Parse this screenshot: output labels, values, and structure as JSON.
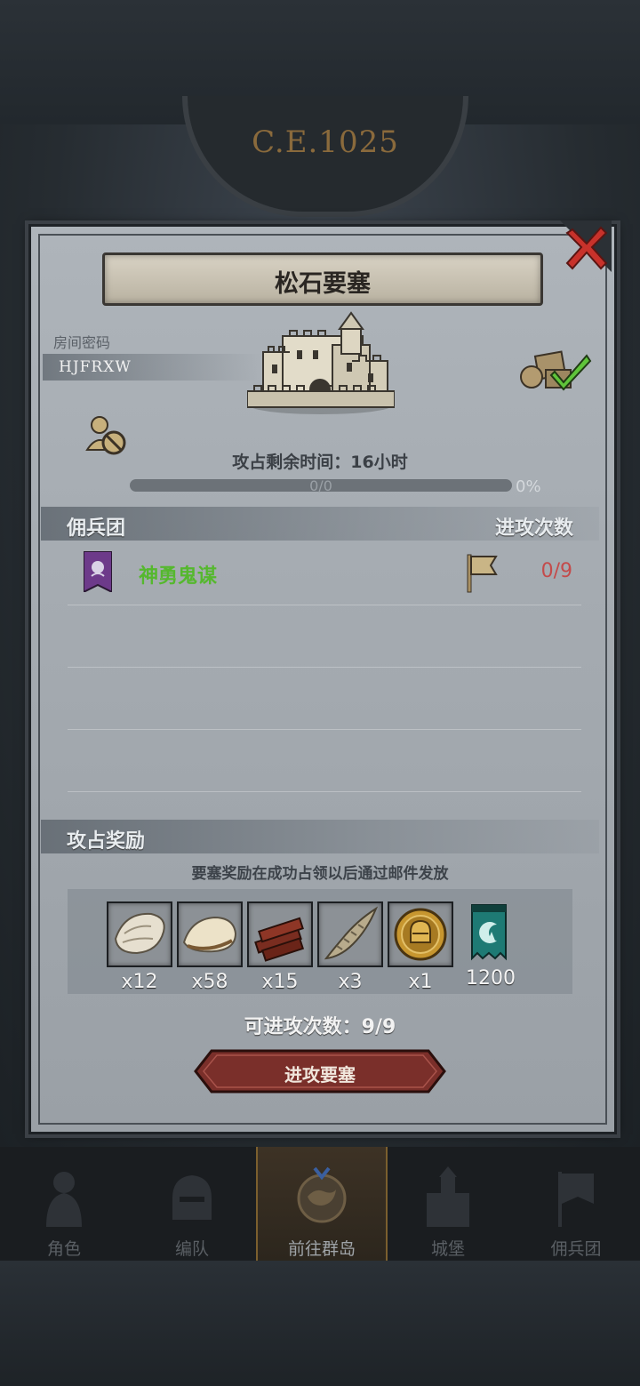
{
  "background": {
    "era_label": "C.E.1025"
  },
  "dialog": {
    "title": "松石要塞",
    "room_label": "房间密码",
    "room_code": "HJFRXW",
    "timer_label": "攻占剩余时间：16小时",
    "progress_text": "0/0",
    "progress_percent_text": "0%",
    "progress_value": 0
  },
  "mercenary": {
    "header_left": "佣兵团",
    "header_right": "进攻次数",
    "rows": [
      {
        "name": "神勇鬼谋",
        "attacks": "0/9"
      }
    ]
  },
  "rewards": {
    "header": "攻占奖励",
    "note": "要塞奖励在成功占领以后通过邮件发放",
    "items": [
      {
        "icon": "fur-pelt-icon",
        "qty": "x12"
      },
      {
        "icon": "wool-hide-icon",
        "qty": "x58"
      },
      {
        "icon": "wood-planks-icon",
        "qty": "x15"
      },
      {
        "icon": "horn-icon",
        "qty": "x3"
      },
      {
        "icon": "gold-helmet-coin-icon",
        "qty": "x1"
      },
      {
        "icon": "guild-banner-currency-icon",
        "qty": "1200"
      }
    ]
  },
  "attacks_left": "可进攻次数：9/9",
  "attack_button": "进攻要塞",
  "nav": {
    "items": [
      {
        "label": "角色"
      },
      {
        "label": "编队"
      },
      {
        "label": "前往群岛",
        "active": true
      },
      {
        "label": "城堡"
      },
      {
        "label": "佣兵团"
      }
    ]
  },
  "colors": {
    "guild_name": "#55b82e",
    "attack_count": "#c44b4b",
    "button": "#7a2f2a"
  }
}
